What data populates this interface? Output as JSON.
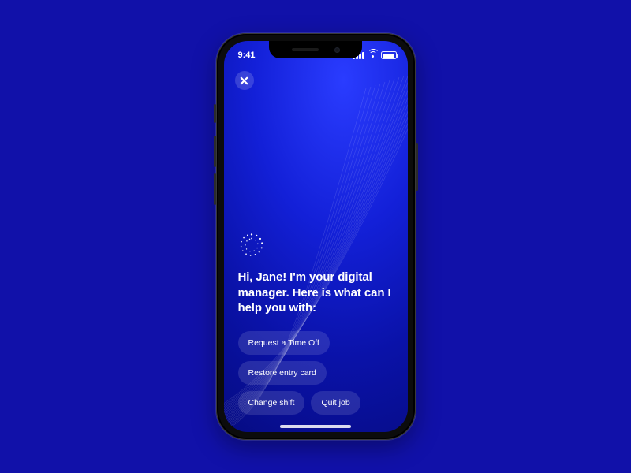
{
  "status": {
    "time": "9:41"
  },
  "greeting": "Hi, Jane! I'm your digital manager. Here is what can I help you with:",
  "actions": {
    "request_time_off": "Request a Time Off",
    "restore_card": "Restore entry card",
    "change_shift": "Change shift",
    "quit_job": "Quit job"
  },
  "colors": {
    "page_bg": "#1111a9",
    "accent": "#2a3cff"
  }
}
